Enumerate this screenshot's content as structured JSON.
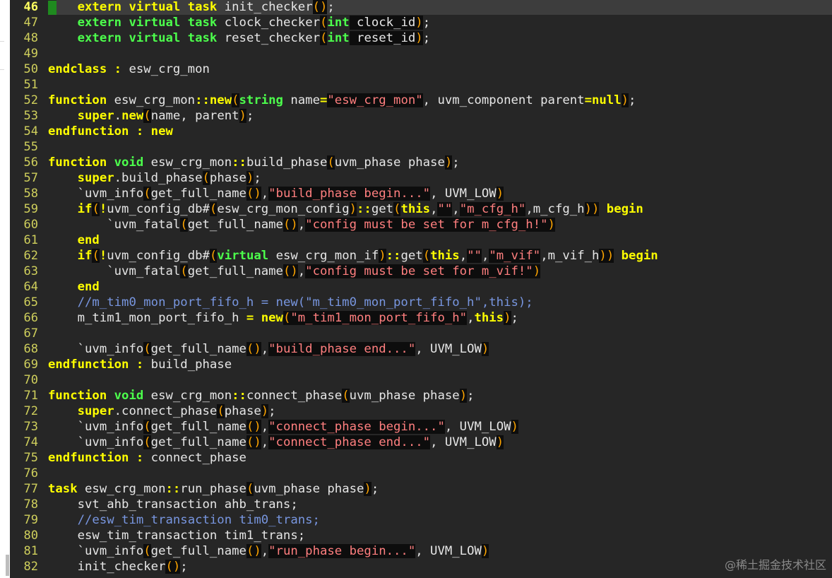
{
  "editor": {
    "current_line": "46",
    "lines": [
      {
        "num": "46",
        "tokens": [
          [
            "",
            "    "
          ],
          [
            "k",
            "extern"
          ],
          [
            "",
            " "
          ],
          [
            "k",
            "virtual"
          ],
          [
            "",
            " "
          ],
          [
            "k",
            "task"
          ],
          [
            "",
            " init_checker"
          ],
          [
            "p",
            "()"
          ],
          [
            "",
            ";"
          ]
        ]
      },
      {
        "num": "47",
        "tokens": [
          [
            "",
            "    "
          ],
          [
            "t",
            "extern"
          ],
          [
            "",
            " "
          ],
          [
            "t",
            "virtual"
          ],
          [
            "",
            " "
          ],
          [
            "t",
            "task"
          ],
          [
            "",
            " clock_checker"
          ],
          [
            "p",
            "("
          ],
          [
            "t",
            "int"
          ],
          [
            "d",
            " clock_id"
          ],
          [
            "p",
            ")"
          ],
          [
            "",
            ";"
          ]
        ]
      },
      {
        "num": "48",
        "tokens": [
          [
            "",
            "    "
          ],
          [
            "t",
            "extern"
          ],
          [
            "",
            " "
          ],
          [
            "t",
            "virtual"
          ],
          [
            "",
            " "
          ],
          [
            "t",
            "task"
          ],
          [
            "",
            " reset_checker"
          ],
          [
            "p",
            "("
          ],
          [
            "t",
            "int"
          ],
          [
            "d",
            " reset_id"
          ],
          [
            "p",
            ")"
          ],
          [
            "",
            ";"
          ]
        ]
      },
      {
        "num": "49",
        "tokens": []
      },
      {
        "num": "50",
        "tokens": [
          [
            "k",
            "endclass"
          ],
          [
            "",
            " "
          ],
          [
            "k",
            ":"
          ],
          [
            "",
            " esw_crg_mon"
          ]
        ]
      },
      {
        "num": "51",
        "tokens": []
      },
      {
        "num": "52",
        "tokens": [
          [
            "k",
            "function"
          ],
          [
            "",
            " esw_crg_mon"
          ],
          [
            "k",
            "::"
          ],
          [
            "k",
            "new"
          ],
          [
            "p",
            "("
          ],
          [
            "t",
            "string"
          ],
          [
            "",
            " name"
          ],
          [
            "k",
            "="
          ],
          [
            "s",
            "\"esw_crg_mon\""
          ],
          [
            "",
            ", uvm_component parent"
          ],
          [
            "k",
            "="
          ],
          [
            "k",
            "null"
          ],
          [
            "p",
            ")"
          ],
          [
            "",
            ";"
          ]
        ]
      },
      {
        "num": "53",
        "tokens": [
          [
            "",
            "    "
          ],
          [
            "k",
            "super"
          ],
          [
            "",
            "."
          ],
          [
            "k",
            "new"
          ],
          [
            "p",
            "("
          ],
          [
            "",
            "name, parent"
          ],
          [
            "p",
            ")"
          ],
          [
            "",
            ";"
          ]
        ]
      },
      {
        "num": "54",
        "tokens": [
          [
            "k",
            "endfunction"
          ],
          [
            "",
            " "
          ],
          [
            "k",
            ":"
          ],
          [
            "",
            " "
          ],
          [
            "k",
            "new"
          ]
        ]
      },
      {
        "num": "55",
        "tokens": []
      },
      {
        "num": "56",
        "tokens": [
          [
            "k",
            "function"
          ],
          [
            "",
            " "
          ],
          [
            "t",
            "void"
          ],
          [
            "",
            " esw_crg_mon"
          ],
          [
            "k",
            "::"
          ],
          [
            "",
            "build_phase"
          ],
          [
            "p",
            "("
          ],
          [
            "",
            "uvm_phase phase"
          ],
          [
            "p",
            ")"
          ],
          [
            "",
            ";"
          ]
        ]
      },
      {
        "num": "57",
        "tokens": [
          [
            "",
            "    "
          ],
          [
            "k",
            "super"
          ],
          [
            "",
            ".build_phase"
          ],
          [
            "p",
            "("
          ],
          [
            "",
            "phase"
          ],
          [
            "p",
            ")"
          ],
          [
            "",
            ";"
          ]
        ]
      },
      {
        "num": "58",
        "tokens": [
          [
            "",
            "    `uvm_info"
          ],
          [
            "p",
            "("
          ],
          [
            "",
            "get_full_name"
          ],
          [
            "p",
            "()"
          ],
          [
            "",
            ","
          ],
          [
            "s",
            "\"build_phase begin...\""
          ],
          [
            "",
            ", UVM_LOW"
          ],
          [
            "p",
            ")"
          ]
        ]
      },
      {
        "num": "59",
        "tokens": [
          [
            "",
            "    "
          ],
          [
            "k",
            "if"
          ],
          [
            "p",
            "("
          ],
          [
            "k",
            "!"
          ],
          [
            "",
            "uvm_config_db#"
          ],
          [
            "p",
            "("
          ],
          [
            "",
            "esw_crg_mon_config"
          ],
          [
            "p",
            ")"
          ],
          [
            "k",
            "::"
          ],
          [
            "",
            "get"
          ],
          [
            "p",
            "("
          ],
          [
            "k",
            "this"
          ],
          [
            "",
            ","
          ],
          [
            "s",
            "\"\""
          ],
          [
            "",
            ","
          ],
          [
            "s",
            "\"m_cfg_h\""
          ],
          [
            "",
            ",m_cfg_h"
          ],
          [
            "p",
            "))"
          ],
          [
            "",
            " "
          ],
          [
            "k",
            "begin"
          ]
        ]
      },
      {
        "num": "60",
        "tokens": [
          [
            "",
            "        `uvm_fatal"
          ],
          [
            "p",
            "("
          ],
          [
            "",
            "get_full_name"
          ],
          [
            "p",
            "()"
          ],
          [
            "",
            ","
          ],
          [
            "s",
            "\"config must be set for m_cfg_h!\""
          ],
          [
            "p",
            ")"
          ]
        ]
      },
      {
        "num": "61",
        "tokens": [
          [
            "",
            "    "
          ],
          [
            "k",
            "end"
          ]
        ]
      },
      {
        "num": "62",
        "tokens": [
          [
            "",
            "    "
          ],
          [
            "k",
            "if"
          ],
          [
            "p",
            "("
          ],
          [
            "k",
            "!"
          ],
          [
            "",
            "uvm_config_db#"
          ],
          [
            "p",
            "("
          ],
          [
            "t",
            "virtual"
          ],
          [
            "",
            " esw_crg_mon_if"
          ],
          [
            "p",
            ")"
          ],
          [
            "k",
            "::"
          ],
          [
            "",
            "get"
          ],
          [
            "p",
            "("
          ],
          [
            "k",
            "this"
          ],
          [
            "",
            ","
          ],
          [
            "s",
            "\"\""
          ],
          [
            "",
            ","
          ],
          [
            "s",
            "\"m_vif\""
          ],
          [
            "",
            ",m_vif_h"
          ],
          [
            "p",
            "))"
          ],
          [
            "",
            " "
          ],
          [
            "k",
            "begin"
          ]
        ]
      },
      {
        "num": "63",
        "tokens": [
          [
            "",
            "        `uvm_fatal"
          ],
          [
            "p",
            "("
          ],
          [
            "",
            "get_full_name"
          ],
          [
            "p",
            "()"
          ],
          [
            "",
            ","
          ],
          [
            "s",
            "\"config must be set for m_vif!\""
          ],
          [
            "p",
            ")"
          ]
        ]
      },
      {
        "num": "64",
        "tokens": [
          [
            "",
            "    "
          ],
          [
            "k",
            "end"
          ]
        ]
      },
      {
        "num": "65",
        "tokens": [
          [
            "",
            "    "
          ],
          [
            "c",
            "//m_tim0_mon_port_fifo_h = new(\"m_tim0_mon_port_fifo_h\",this);"
          ]
        ]
      },
      {
        "num": "66",
        "tokens": [
          [
            "",
            "    m_tim1_mon_port_fifo_h "
          ],
          [
            "k",
            "="
          ],
          [
            "",
            " "
          ],
          [
            "k",
            "new"
          ],
          [
            "p",
            "("
          ],
          [
            "s",
            "\"m_tim1_mon_port_fifo_h\""
          ],
          [
            "",
            ","
          ],
          [
            "k",
            "this"
          ],
          [
            "p",
            ")"
          ],
          [
            "",
            ";"
          ]
        ]
      },
      {
        "num": "67",
        "tokens": []
      },
      {
        "num": "68",
        "tokens": [
          [
            "",
            "    `uvm_info"
          ],
          [
            "p",
            "("
          ],
          [
            "",
            "get_full_name"
          ],
          [
            "p",
            "()"
          ],
          [
            "",
            ","
          ],
          [
            "s",
            "\"build_phase end...\""
          ],
          [
            "",
            ", UVM_LOW"
          ],
          [
            "p",
            ")"
          ]
        ]
      },
      {
        "num": "69",
        "tokens": [
          [
            "k",
            "endfunction"
          ],
          [
            "",
            " "
          ],
          [
            "k",
            ":"
          ],
          [
            "",
            " build_phase"
          ]
        ]
      },
      {
        "num": "70",
        "tokens": []
      },
      {
        "num": "71",
        "tokens": [
          [
            "k",
            "function"
          ],
          [
            "",
            " "
          ],
          [
            "t",
            "void"
          ],
          [
            "",
            " esw_crg_mon"
          ],
          [
            "k",
            "::"
          ],
          [
            "",
            "connect_phase"
          ],
          [
            "p",
            "("
          ],
          [
            "",
            "uvm_phase phase"
          ],
          [
            "p",
            ")"
          ],
          [
            "",
            ";"
          ]
        ]
      },
      {
        "num": "72",
        "tokens": [
          [
            "",
            "    "
          ],
          [
            "k",
            "super"
          ],
          [
            "",
            ".connect_phase"
          ],
          [
            "p",
            "("
          ],
          [
            "",
            "phase"
          ],
          [
            "p",
            ")"
          ],
          [
            "",
            ";"
          ]
        ]
      },
      {
        "num": "73",
        "tokens": [
          [
            "",
            "    `uvm_info"
          ],
          [
            "p",
            "("
          ],
          [
            "",
            "get_full_name"
          ],
          [
            "p",
            "()"
          ],
          [
            "",
            ","
          ],
          [
            "s",
            "\"connect_phase begin...\""
          ],
          [
            "",
            ", UVM_LOW"
          ],
          [
            "p",
            ")"
          ]
        ]
      },
      {
        "num": "74",
        "tokens": [
          [
            "",
            "    `uvm_info"
          ],
          [
            "p",
            "("
          ],
          [
            "",
            "get_full_name"
          ],
          [
            "p",
            "()"
          ],
          [
            "",
            ","
          ],
          [
            "s",
            "\"connect_phase end...\""
          ],
          [
            "",
            ", UVM_LOW"
          ],
          [
            "p",
            ")"
          ]
        ]
      },
      {
        "num": "75",
        "tokens": [
          [
            "k",
            "endfunction"
          ],
          [
            "",
            " "
          ],
          [
            "k",
            ":"
          ],
          [
            "",
            " connect_phase"
          ]
        ]
      },
      {
        "num": "76",
        "tokens": []
      },
      {
        "num": "77",
        "tokens": [
          [
            "k",
            "task"
          ],
          [
            "",
            " esw_crg_mon"
          ],
          [
            "k",
            "::"
          ],
          [
            "",
            "run_phase"
          ],
          [
            "p",
            "("
          ],
          [
            "",
            "uvm_phase phase"
          ],
          [
            "p",
            ")"
          ],
          [
            "",
            ";"
          ]
        ]
      },
      {
        "num": "78",
        "tokens": [
          [
            "",
            "    svt_ahb_transaction ahb_trans;"
          ]
        ]
      },
      {
        "num": "79",
        "tokens": [
          [
            "",
            "    "
          ],
          [
            "c",
            "//esw_tim_transaction tim0_trans;"
          ]
        ]
      },
      {
        "num": "80",
        "tokens": [
          [
            "",
            "    esw_tim_transaction tim1_trans;"
          ]
        ]
      },
      {
        "num": "81",
        "tokens": [
          [
            "",
            "    `uvm_info"
          ],
          [
            "p",
            "("
          ],
          [
            "",
            "get_full_name"
          ],
          [
            "p",
            "()"
          ],
          [
            "",
            ","
          ],
          [
            "s",
            "\"run_phase begin...\""
          ],
          [
            "",
            ", UVM_LOW"
          ],
          [
            "p",
            ")"
          ]
        ]
      },
      {
        "num": "82",
        "tokens": [
          [
            "",
            "    init_checker"
          ],
          [
            "p",
            "()"
          ],
          [
            "",
            ";"
          ]
        ]
      }
    ]
  },
  "watermark": "@稀土掘金技术社区",
  "colors": {
    "background": "#262626",
    "keyword": "#ffff00",
    "type": "#4cff4c",
    "string": "#ff7f7f",
    "paren": "#ffa500",
    "comment": "#7896e0",
    "line_number": "#cfcf5c"
  }
}
